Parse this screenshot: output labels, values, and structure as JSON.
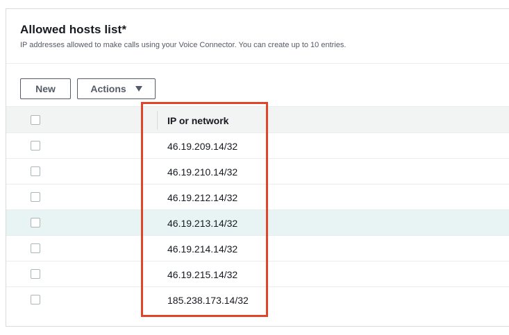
{
  "panel": {
    "title": "Allowed hosts list*",
    "description": "IP addresses allowed to make calls using your Voice Connector. You can create up to 10 entries."
  },
  "toolbar": {
    "new_label": "New",
    "actions_label": "Actions"
  },
  "table": {
    "column_header": "IP or network",
    "rows": [
      {
        "ip": "46.19.209.14/32",
        "selected": false
      },
      {
        "ip": "46.19.210.14/32",
        "selected": false
      },
      {
        "ip": "46.19.212.14/32",
        "selected": false
      },
      {
        "ip": "46.19.213.14/32",
        "selected": false,
        "highlighted": true
      },
      {
        "ip": "46.19.214.14/32",
        "selected": false
      },
      {
        "ip": "46.19.215.14/32",
        "selected": false
      },
      {
        "ip": "185.238.173.14/32",
        "selected": false
      }
    ]
  },
  "colors": {
    "annotation_border": "#e0452a",
    "row_highlight": "#e8f4f4",
    "header_bg": "#f2f3f3"
  }
}
